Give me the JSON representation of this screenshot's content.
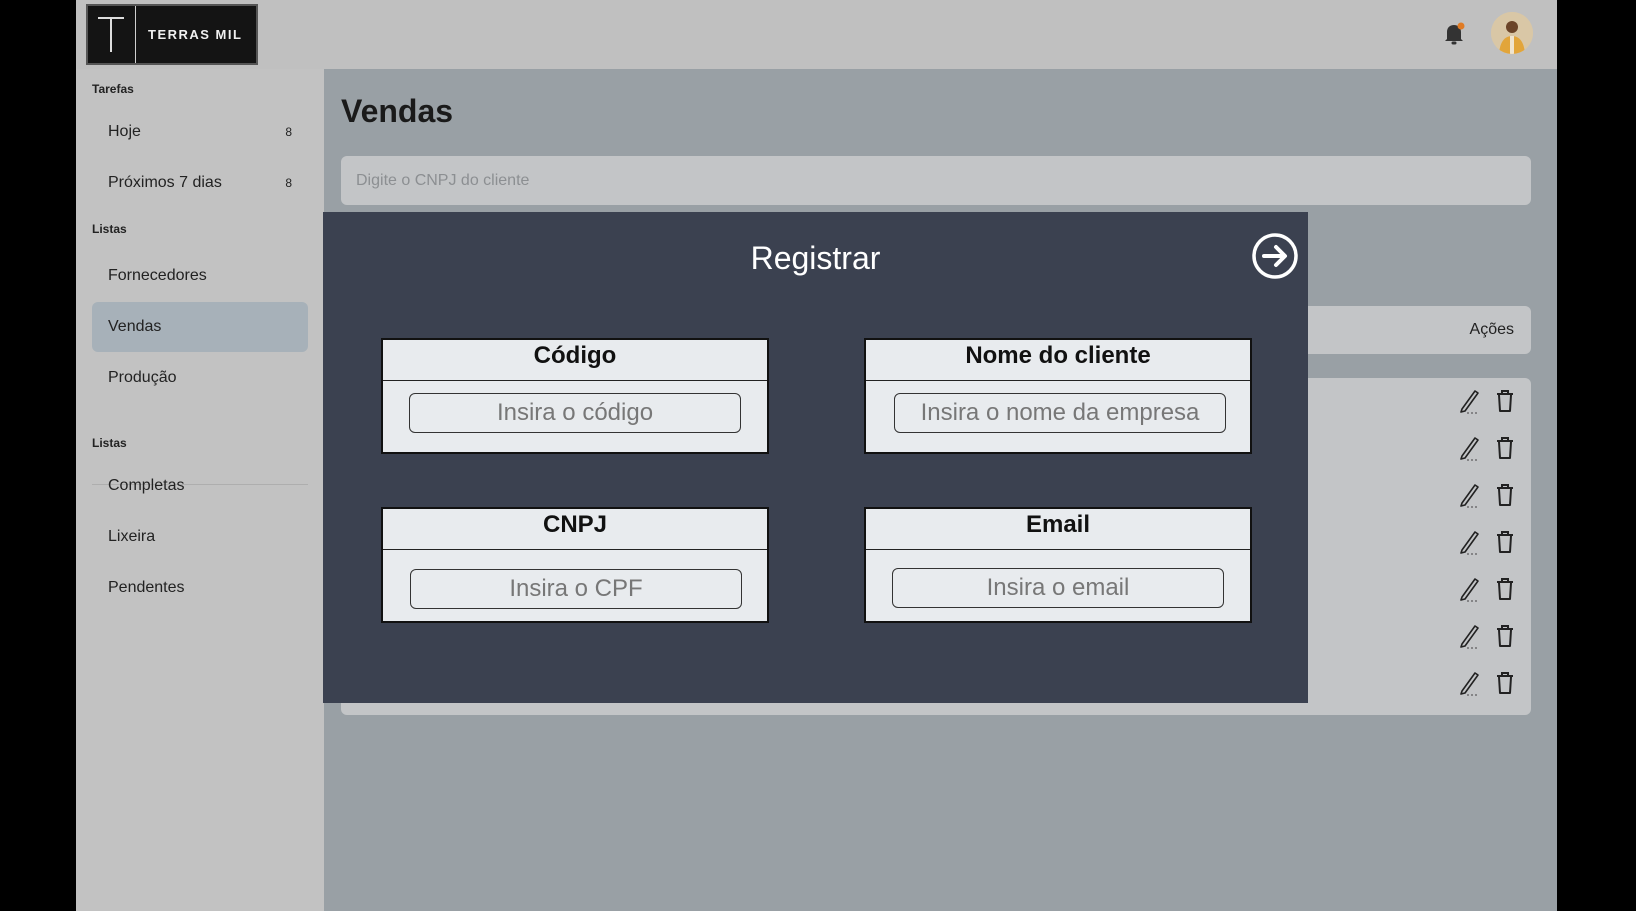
{
  "brand": {
    "name": "TERRAS MIL"
  },
  "sidebar": {
    "sections": [
      {
        "title": "Tarefas"
      },
      {
        "title": "Listas"
      },
      {
        "title": "Listas"
      }
    ],
    "items": [
      {
        "label": "Hoje",
        "count": "8"
      },
      {
        "label": "Próximos 7 dias",
        "count": "8"
      },
      {
        "label": "Fornecedores"
      },
      {
        "label": "Vendas",
        "active": true
      },
      {
        "label": "Produção"
      },
      {
        "label": "Completas"
      },
      {
        "label": "Lixeira"
      },
      {
        "label": "Pendentes"
      }
    ]
  },
  "header": {
    "notification_icon": "bell-icon",
    "avatar_icon": "user-avatar"
  },
  "main": {
    "title": "Vendas",
    "search": {
      "placeholder": "Digite o CNPJ do cliente",
      "value": ""
    },
    "table": {
      "actions_header": "Ações",
      "row_count": 7
    }
  },
  "modal": {
    "title": "Registrar",
    "close_icon": "arrow-right-circle-icon",
    "fields": [
      {
        "label": "Código",
        "placeholder": "Insira o código"
      },
      {
        "label": "Nome do cliente",
        "placeholder": "Insira o nome da empresa"
      },
      {
        "label": "CNPJ",
        "placeholder": "Insira o CPF"
      },
      {
        "label": "Email",
        "placeholder": "Insira o email"
      }
    ]
  },
  "colors": {
    "overlay_main": "#99a0a5",
    "sidebar": "#c2c2c2",
    "modal_bg": "#3b4150",
    "field_bg": "#e8ebee",
    "active_item": "#a7b1b9",
    "notification_dot": "#e07b24"
  }
}
